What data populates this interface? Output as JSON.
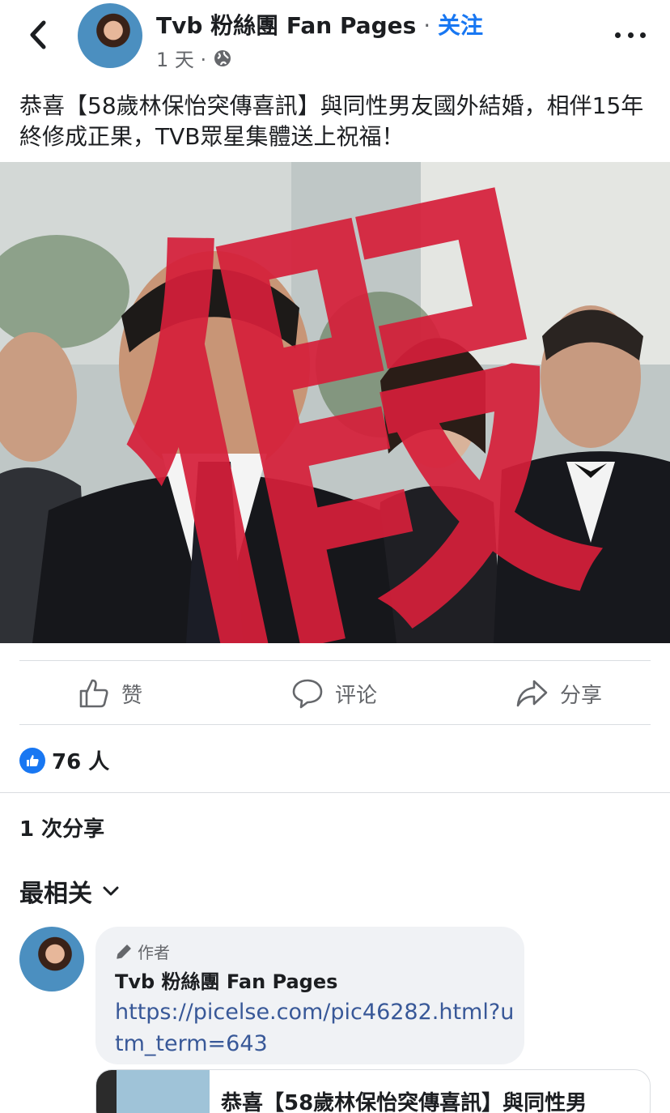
{
  "header": {
    "back_icon": "chevron-left-icon",
    "page_name": "Tvb 粉絲團 Fan Pages",
    "separator": " · ",
    "follow_label": "关注",
    "time": "1 天 ·",
    "privacy_icon": "globe-icon",
    "more_icon": "more-horizontal-icon"
  },
  "post": {
    "caption": "恭喜【58歲林保怡突傳喜訊】與同性男友國外結婚，相伴15年終修成正果，TVB眾星集體送上祝福！",
    "image_overlay_text": "假"
  },
  "actions": {
    "like_label": "赞",
    "comment_label": "评论",
    "share_label": "分享"
  },
  "stats": {
    "reaction_count": "76 人",
    "share_count": "1 次分享"
  },
  "comments": {
    "sort_label": "最相关",
    "items": [
      {
        "author_badge": "作者",
        "name": "Tvb 粉絲團 Fan Pages",
        "link": "https://picelse.com/pic46282.html?utm_term=643"
      }
    ]
  },
  "preview": {
    "title": "恭喜【58歲林保怡突傳喜訊】與同性男"
  },
  "colors": {
    "accent": "#1877f2",
    "stamp_red": "#d61f3a",
    "link": "#385898"
  }
}
